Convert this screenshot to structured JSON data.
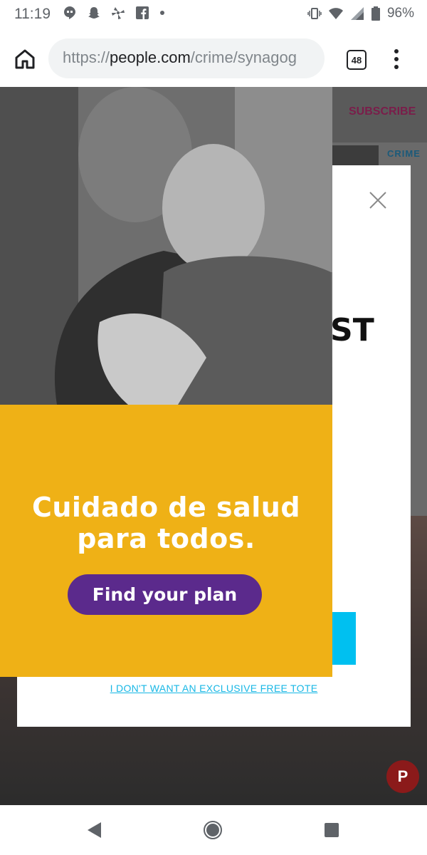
{
  "status_bar": {
    "time": "11:19",
    "battery": "96%",
    "left_icons": [
      "hangouts-icon",
      "snapchat-icon",
      "pinwheel-icon",
      "facebook-icon",
      "dot-icon"
    ],
    "right_icons": [
      "vibrate-icon",
      "wifi-icon",
      "signal-icon",
      "battery-icon"
    ]
  },
  "browser": {
    "url_scheme": "https://",
    "url_domain": "people.com",
    "url_path": "/crime/synagog",
    "tab_count": "48"
  },
  "page": {
    "subscribe_label": "SUBSCRIBE",
    "crime_label": "CRIME"
  },
  "modal": {
    "heading_fragment": "ST",
    "decline_link": "I DON'T WANT AN EXCLUSIVE FREE TOTE"
  },
  "ad": {
    "headline_line1": "Cuidado de salud",
    "headline_line2": "para todos.",
    "button_label": "Find your plan"
  },
  "colors": {
    "ad_yellow": "#efb116",
    "ad_button": "#5b2a8c",
    "link_cyan": "#17b7e5",
    "cta_cyan": "#00c0f0",
    "subscribe": "#7a1d4a"
  }
}
